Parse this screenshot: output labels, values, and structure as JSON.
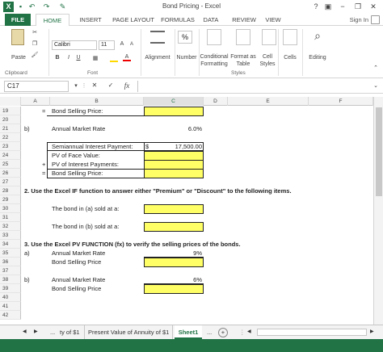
{
  "window": {
    "title": "Bond Pricing - Excel",
    "help": "?",
    "minimize": "−",
    "restore": "❐",
    "close": "✕"
  },
  "quick_access": {
    "undo": "↶",
    "redo": "↷",
    "save": "💾",
    "touch": "☝"
  },
  "tabs": [
    "FILE",
    "HOME",
    "INSERT",
    "PAGE LAYOUT",
    "FORMULAS",
    "DATA",
    "REVIEW",
    "VIEW"
  ],
  "signin": "Sign In",
  "ribbon": {
    "paste_label": "Paste",
    "clipboard_label": "Clipboard",
    "font_name": "Calibri",
    "font_size": "11",
    "bold": "B",
    "italic": "I",
    "underline": "U",
    "font_label": "Font",
    "alignment_label": "Alignment",
    "number_label": "Number",
    "percent": "%",
    "cond_format_label": "Conditional Formatting",
    "format_table_label": "Format as Table",
    "cell_styles_label": "Cell Styles",
    "styles_label": "Styles",
    "cells_label": "Cells",
    "editing_label": "Editing"
  },
  "formula_bar": {
    "name_box": "C17",
    "cancel": "✕",
    "enter": "✓",
    "fx": "fx",
    "value": ""
  },
  "columns": [
    "A",
    "B",
    "C",
    "D",
    "E",
    "F"
  ],
  "rows": [
    "19",
    "20",
    "21",
    "22",
    "23",
    "24",
    "25",
    "26",
    "27",
    "28",
    "29",
    "30",
    "31",
    "32",
    "33",
    "34",
    "35",
    "36",
    "37",
    "38",
    "39",
    "40",
    "41",
    "42"
  ],
  "cells": {
    "r19_a": "=",
    "r19_b": "Bond Selling Price:",
    "r21_a": "b)",
    "r21_b": "Annual Market Rate",
    "r21_c": "6.0%",
    "r23_b": "Semiannual Interest Payment:",
    "r23_c_sym": "$",
    "r23_c": "17,500.00",
    "r24_b": "PV of Face Value:",
    "r25_a": "+",
    "r25_b": "PV of Interest Payments:",
    "r26_a": "=",
    "r26_b": "Bond Selling Price:",
    "r28": "2.  Use the Excel IF function to answer either \"Premium\" or \"Discount\" to the following items.",
    "r30_b": "The bond in (a) sold at a:",
    "r32_b": "The bond in (b) sold at a:",
    "r34": "3.  Use the Excel PV FUNCTION (fx) to verify the selling prices of the bonds.",
    "r35_a": "a)",
    "r35_b": "Annual Market Rate",
    "r35_c": "9%",
    "r36_b": "Bond Selling Price",
    "r38_a": "b)",
    "r38_b": "Annual Market Rate",
    "r38_c": "6%",
    "r39_b": "Bond Selling Price"
  },
  "sheet_tabs": {
    "prev": "◀",
    "next": "▶",
    "more_left": "...",
    "tab1": "ty of $1",
    "tab2": "Present Value of Annuity of $1",
    "tab3": "Sheet1",
    "more_right": "...",
    "add": "+"
  },
  "colors": {
    "accent": "#217346",
    "input_fill": "#ffff66"
  }
}
